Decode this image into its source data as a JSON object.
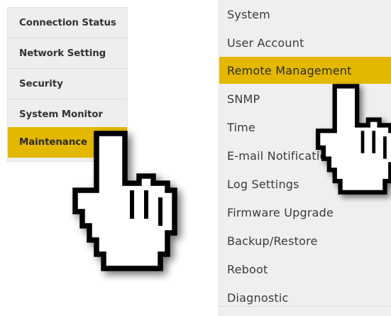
{
  "left_menu": {
    "items": [
      {
        "label": "Connection Status"
      },
      {
        "label": "Network Setting"
      },
      {
        "label": "Security"
      },
      {
        "label": "System Monitor"
      },
      {
        "label": "Maintenance"
      }
    ],
    "active_index": 4
  },
  "right_menu": {
    "items": [
      {
        "label": "System"
      },
      {
        "label": "User Account"
      },
      {
        "label": "Remote Management"
      },
      {
        "label": "SNMP"
      },
      {
        "label": "Time"
      },
      {
        "label": "E-mail Notification"
      },
      {
        "label": "Log Settings"
      },
      {
        "label": "Firmware Upgrade"
      },
      {
        "label": "Backup/Restore"
      },
      {
        "label": "Reboot"
      },
      {
        "label": "Diagnostic"
      }
    ],
    "active_index": 2
  },
  "colors": {
    "highlight": "#e5b800",
    "menu_background": "#eeeeee",
    "text": "#333333"
  },
  "icons": {
    "left_pointer": "hand-pointer-icon",
    "right_pointer": "hand-pointer-icon"
  }
}
